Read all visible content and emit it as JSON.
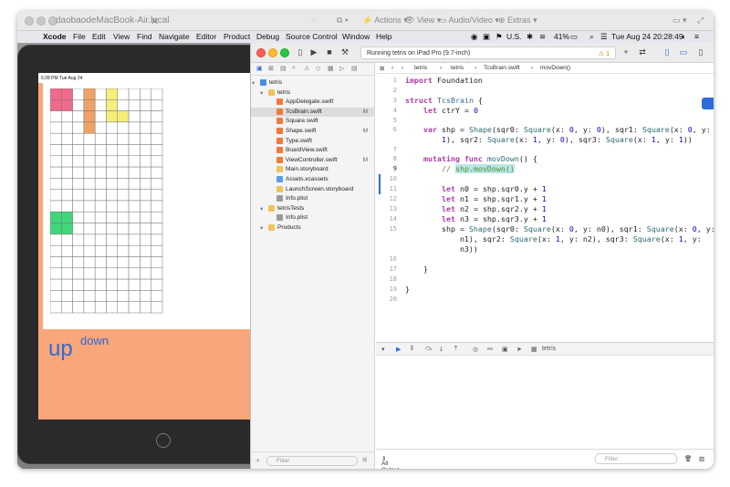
{
  "host": {
    "title": "daobaodeMacBook-Air.local",
    "actions": "Actions",
    "view": "View",
    "audio_video": "Audio/Video",
    "extras": "Extras"
  },
  "menubar": {
    "items": [
      "Xcode",
      "File",
      "Edit",
      "View",
      "Find",
      "Navigate",
      "Editor",
      "Product",
      "Debug",
      "Source Control",
      "Window",
      "Help"
    ],
    "input_source": "U.S.",
    "battery": "41%",
    "clock": "Tue Aug 24  20:28:49"
  },
  "ipad": {
    "status_time": "6:28 PM",
    "status_date": "Tue Aug 24",
    "up_label": "up",
    "down_label": "down",
    "board": {
      "cols": 10,
      "rows": 20,
      "filled": [
        {
          "col": 0,
          "row": 0,
          "color": "#f06a8c"
        },
        {
          "col": 1,
          "row": 0,
          "color": "#f06a8c"
        },
        {
          "col": 0,
          "row": 1,
          "color": "#f06a8c"
        },
        {
          "col": 1,
          "row": 1,
          "color": "#f06a8c"
        },
        {
          "col": 3,
          "row": 0,
          "color": "#f0a266"
        },
        {
          "col": 3,
          "row": 1,
          "color": "#f0a266"
        },
        {
          "col": 3,
          "row": 2,
          "color": "#f0a266"
        },
        {
          "col": 3,
          "row": 3,
          "color": "#f0a266"
        },
        {
          "col": 5,
          "row": 0,
          "color": "#f5ef7a"
        },
        {
          "col": 5,
          "row": 1,
          "color": "#f5ef7a"
        },
        {
          "col": 5,
          "row": 2,
          "color": "#f5ef7a"
        },
        {
          "col": 6,
          "row": 2,
          "color": "#f5ef7a"
        },
        {
          "col": 0,
          "row": 11,
          "color": "#3fd77a"
        },
        {
          "col": 1,
          "row": 11,
          "color": "#3fd77a"
        },
        {
          "col": 0,
          "row": 12,
          "color": "#3fd77a"
        },
        {
          "col": 1,
          "row": 12,
          "color": "#3fd77a"
        }
      ]
    }
  },
  "xcode": {
    "run_status": "Running tetris on iPad Pro (9.7-inch)",
    "warning_count": "1",
    "navigator": [
      {
        "label": "tetris",
        "kind": "project",
        "indent": 0,
        "mark": ""
      },
      {
        "label": "tetris",
        "kind": "folder",
        "indent": 1,
        "mark": ""
      },
      {
        "label": "AppDelegate.swift",
        "kind": "swift",
        "indent": 2,
        "mark": ""
      },
      {
        "label": "TcsBrain.swift",
        "kind": "swift",
        "indent": 2,
        "mark": "M",
        "selected": true
      },
      {
        "label": "Square.swift",
        "kind": "swift",
        "indent": 2,
        "mark": ""
      },
      {
        "label": "Shape.swift",
        "kind": "swift",
        "indent": 2,
        "mark": "M"
      },
      {
        "label": "Type.swift",
        "kind": "swift",
        "indent": 2,
        "mark": ""
      },
      {
        "label": "BoardView.swift",
        "kind": "swift",
        "indent": 2,
        "mark": ""
      },
      {
        "label": "ViewController.swift",
        "kind": "swift",
        "indent": 2,
        "mark": "M"
      },
      {
        "label": "Main.storyboard",
        "kind": "storyboard",
        "indent": 2,
        "mark": ""
      },
      {
        "label": "Assets.xcassets",
        "kind": "assets",
        "indent": 2,
        "mark": ""
      },
      {
        "label": "LaunchScreen.storyboard",
        "kind": "storyboard",
        "indent": 2,
        "mark": ""
      },
      {
        "label": "Info.plist",
        "kind": "plist",
        "indent": 2,
        "mark": ""
      },
      {
        "label": "tetrisTests",
        "kind": "folder",
        "indent": 1,
        "mark": ""
      },
      {
        "label": "Info.plist",
        "kind": "plist",
        "indent": 2,
        "mark": ""
      },
      {
        "label": "Products",
        "kind": "folder",
        "indent": 1,
        "mark": ""
      }
    ],
    "filter_placeholder": "Filter",
    "breadcrumb": [
      "tetris",
      "tetris",
      "TcsBrain.swift",
      "movDown()"
    ],
    "code_lines": [
      "1",
      "2",
      "3",
      "4",
      "5",
      "6",
      "7",
      "8",
      "9",
      "10",
      "11",
      "12",
      "13",
      "14",
      "15",
      "16",
      "17",
      "18",
      "19",
      "20"
    ],
    "debug_target": "tetris",
    "console_scope": "All Output",
    "console_filter_placeholder": "Filter"
  }
}
